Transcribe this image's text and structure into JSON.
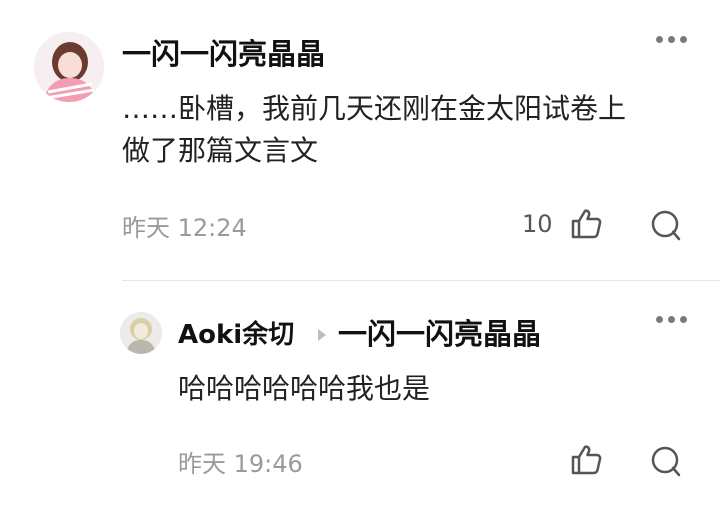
{
  "comments": [
    {
      "username": "一闪一闪亮晶晶",
      "text_line1": "……卧槽，我前几天还刚在金太阳试卷上",
      "text_line2": "做了那篇文言文",
      "time": "昨天 12:24",
      "like_count": "10",
      "icons": {
        "like": "thumbs-up-icon",
        "reply": "comment-icon",
        "more": "more-options-icon"
      }
    },
    {
      "username": "Aoki余切",
      "reply_to": "一闪一闪亮晶晶",
      "text": "哈哈哈哈哈哈我也是",
      "time": "昨天 19:46",
      "icons": {
        "like": "thumbs-up-icon",
        "reply": "comment-icon",
        "more": "more-options-icon"
      }
    }
  ]
}
